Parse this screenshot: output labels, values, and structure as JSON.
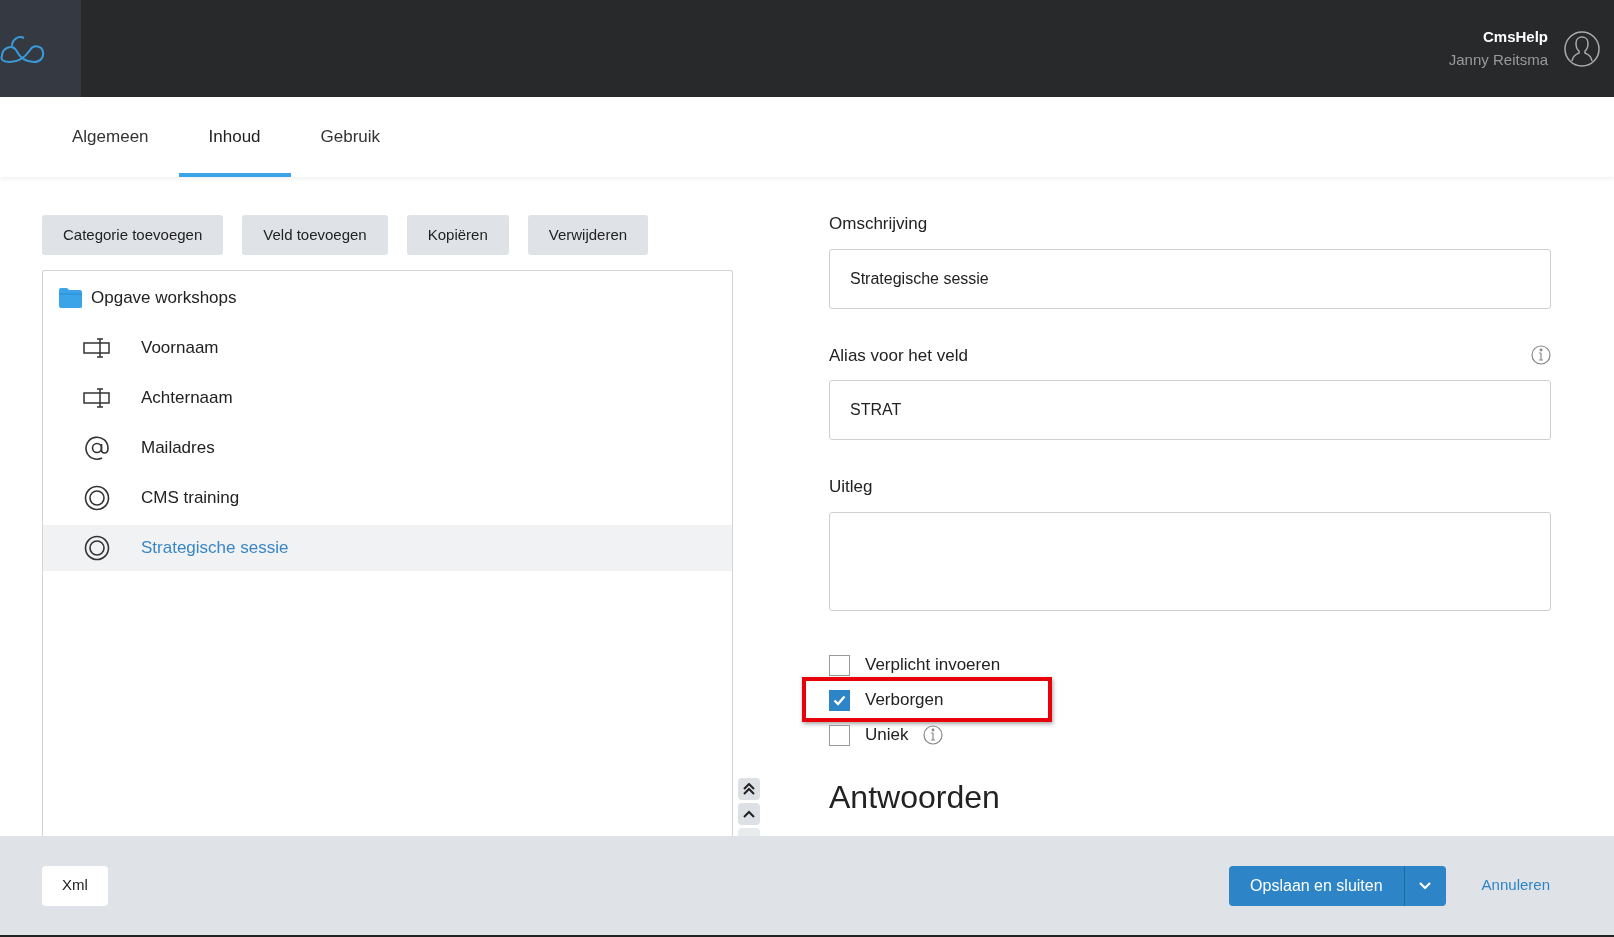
{
  "header": {
    "account": "CmsHelp",
    "user": "Janny Reitsma"
  },
  "tabs": [
    {
      "label": "Algemeen",
      "selected": false
    },
    {
      "label": "Inhoud",
      "selected": true
    },
    {
      "label": "Gebruik",
      "selected": false
    }
  ],
  "toolbar": [
    "Categorie toevoegen",
    "Veld toevoegen",
    "Kopiëren",
    "Verwijderen"
  ],
  "tree": {
    "label": "Opgave workshops",
    "children": [
      {
        "label": "Voornaam",
        "kind": "text",
        "selected": false
      },
      {
        "label": "Achternaam",
        "kind": "text",
        "selected": false
      },
      {
        "label": "Mailadres",
        "kind": "email",
        "selected": false
      },
      {
        "label": "CMS training",
        "kind": "choice",
        "selected": false
      },
      {
        "label": "Strategische sessie",
        "kind": "choice",
        "selected": true
      }
    ]
  },
  "form": {
    "fields": [
      {
        "label": "Omschrijving",
        "value": "Strategische sessie",
        "kind": "input",
        "info": false
      },
      {
        "label": "Alias voor het veld",
        "value": "STRAT",
        "kind": "input",
        "info": true
      },
      {
        "label": "Uitleg",
        "kind": "textarea",
        "info": false
      }
    ],
    "checkboxes": [
      {
        "label": "Verplicht invoeren",
        "checked": false,
        "info": false,
        "highlighted": false
      },
      {
        "label": "Verborgen",
        "checked": true,
        "info": false,
        "highlighted": true
      },
      {
        "label": "Uniek",
        "checked": false,
        "info": true,
        "highlighted": false
      }
    ],
    "section_heading": "Antwoorden"
  },
  "footer": {
    "left_button": "Xml",
    "primary_button": "Opslaan en sluiten",
    "cancel_link": "Annuleren"
  }
}
